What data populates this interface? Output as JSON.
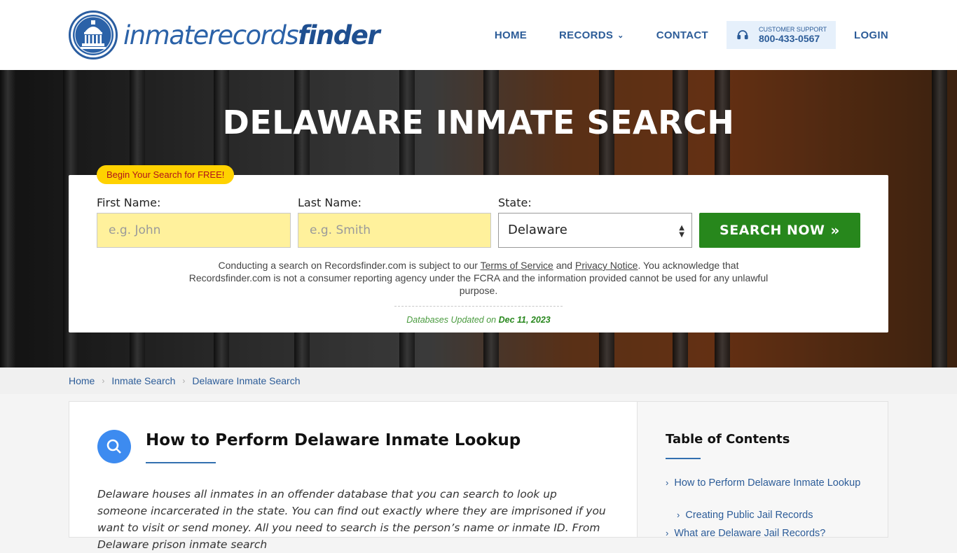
{
  "header": {
    "logo": {
      "text_light": "inmaterecords",
      "text_bold": "finder"
    },
    "nav": [
      {
        "label": "HOME"
      },
      {
        "label": "RECORDS"
      },
      {
        "label": "CONTACT"
      }
    ],
    "support": {
      "label": "CUSTOMER SUPPORT",
      "phone": "800-433-0567"
    },
    "login": "LOGIN"
  },
  "hero": {
    "title": "DELAWARE INMATE SEARCH"
  },
  "search": {
    "badge": "Begin Your Search for FREE!",
    "first_name": {
      "label": "First Name:",
      "placeholder": "e.g. John",
      "value": ""
    },
    "last_name": {
      "label": "Last Name:",
      "placeholder": "e.g. Smith",
      "value": ""
    },
    "state": {
      "label": "State:",
      "value": "Delaware"
    },
    "button": "SEARCH NOW",
    "disclaimer_a": "Conducting a search on Recordsfinder.com is subject to our ",
    "terms": "Terms of Service",
    "and": " and ",
    "privacy": "Privacy Notice",
    "disclaimer_b": ". You acknowledge that Recordsfinder.com is not a consumer reporting agency under the FCRA and the information provided cannot be used for any unlawful purpose.",
    "db_label": "Databases Updated on",
    "db_date": "Dec 11, 2023"
  },
  "breadcrumb": [
    "Home",
    "Inmate Search",
    "Delaware Inmate Search"
  ],
  "main": {
    "title": "How to Perform Delaware Inmate Lookup",
    "intro": "Delaware houses all inmates in an offender database that you can search to look up someone incarcerated in the state. You can find out exactly where they are imprisoned if you want to visit or send money. All you need to search is the person’s name or inmate ID. From Delaware prison inmate search"
  },
  "toc": {
    "title": "Table of Contents",
    "items": [
      {
        "label": "How to Perform Delaware Inmate Lookup"
      },
      {
        "label": "Creating Public Jail Records"
      },
      {
        "label": "What are Delaware Jail Records?"
      }
    ]
  },
  "colors": {
    "brand_blue": "#2c5c98",
    "search_green": "#27871c",
    "field_yellow": "#fff19c",
    "badge_yellow": "#ffd200"
  }
}
